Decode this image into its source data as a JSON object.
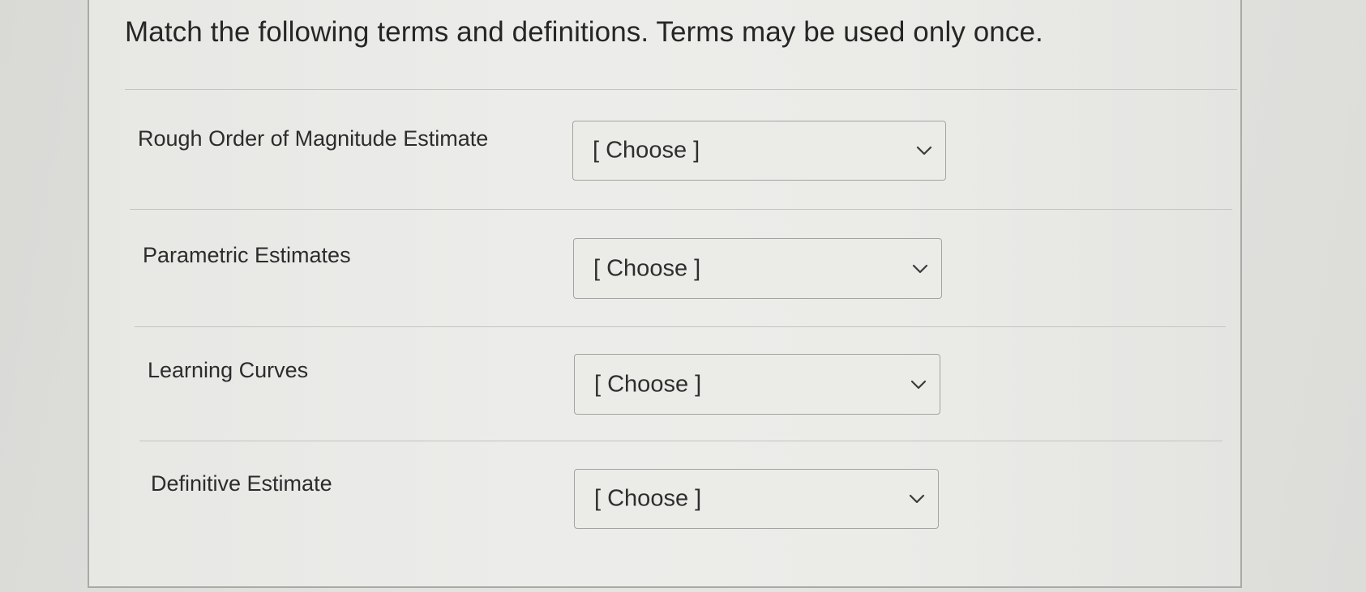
{
  "question": {
    "prompt": "Match the following terms and definitions. Terms may be used only once."
  },
  "rows": [
    {
      "term": "Rough Order of Magnitude Estimate",
      "selected": "[ Choose ]"
    },
    {
      "term": "Parametric Estimates",
      "selected": "[ Choose ]"
    },
    {
      "term": "Learning Curves",
      "selected": "[ Choose ]"
    },
    {
      "term": "Definitive Estimate",
      "selected": "[ Choose ]"
    }
  ],
  "icons": {
    "dropdown": "chevron-down-icon"
  },
  "colors": {
    "background": "#e3e3e0",
    "panel_border": "#a9a9a6",
    "text": "#2b2b2b"
  }
}
